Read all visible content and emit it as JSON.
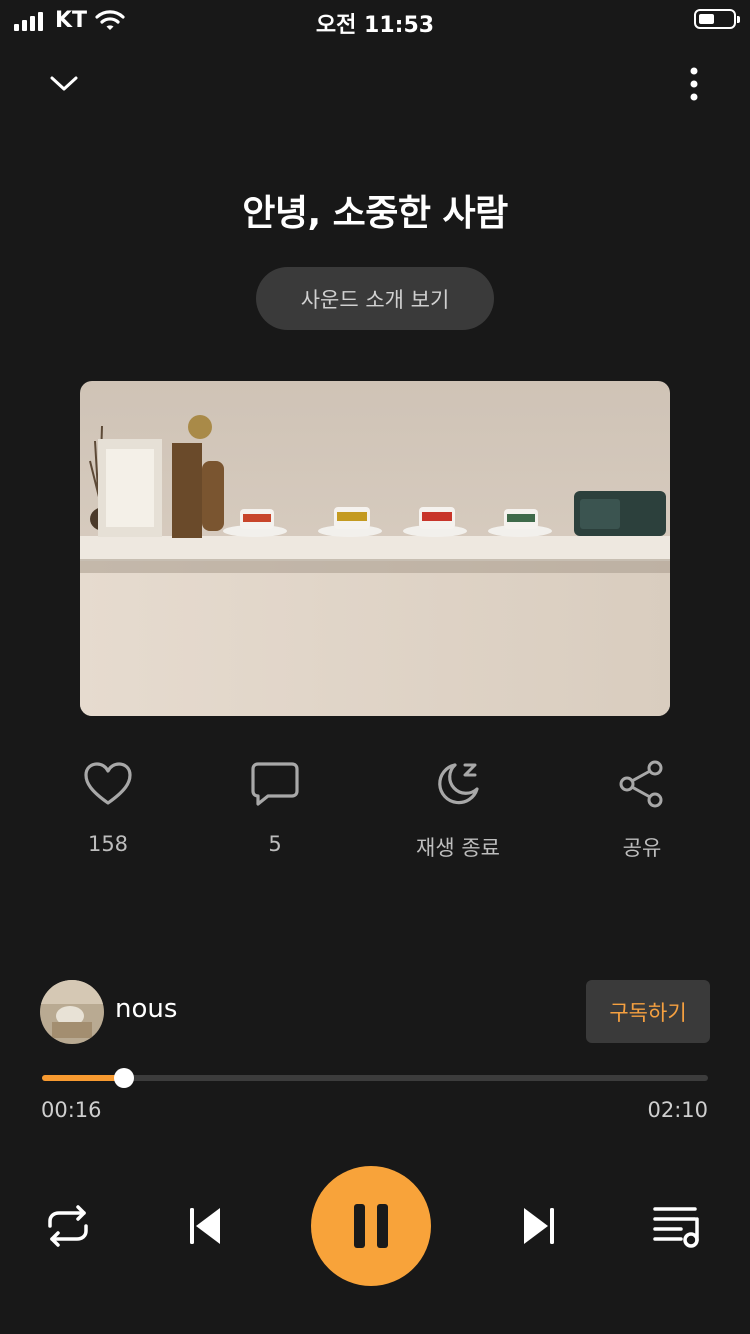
{
  "status_bar": {
    "carrier": "KT",
    "time": "오전 11:53",
    "battery_level": 0.45
  },
  "nav": {
    "collapse_icon": "chevron-down-icon",
    "more_icon": "more-vertical-icon"
  },
  "track": {
    "title": "안녕, 소중한 사람",
    "intro_label": "사운드 소개 보기"
  },
  "actions": {
    "like": {
      "icon": "heart-icon",
      "label": "158"
    },
    "comment": {
      "icon": "comment-icon",
      "label": "5"
    },
    "sleep_timer": {
      "icon": "moon-sleep-icon",
      "label": "재생 종료"
    },
    "share": {
      "icon": "share-icon",
      "label": "공유"
    }
  },
  "creator": {
    "name": "nous",
    "subscribe_label": "구독하기"
  },
  "progress": {
    "current": "00:16",
    "total": "02:10",
    "fraction": 0.123
  },
  "controls": {
    "repeat_icon": "repeat-icon",
    "prev_icon": "skip-previous-icon",
    "play_state_icon": "pause-icon",
    "next_icon": "skip-next-icon",
    "playlist_icon": "playlist-icon"
  },
  "colors": {
    "background": "#181818",
    "accent": "#f8a33a",
    "subscribe_text": "#f5a040",
    "pill_bg": "#3a3a3a"
  }
}
